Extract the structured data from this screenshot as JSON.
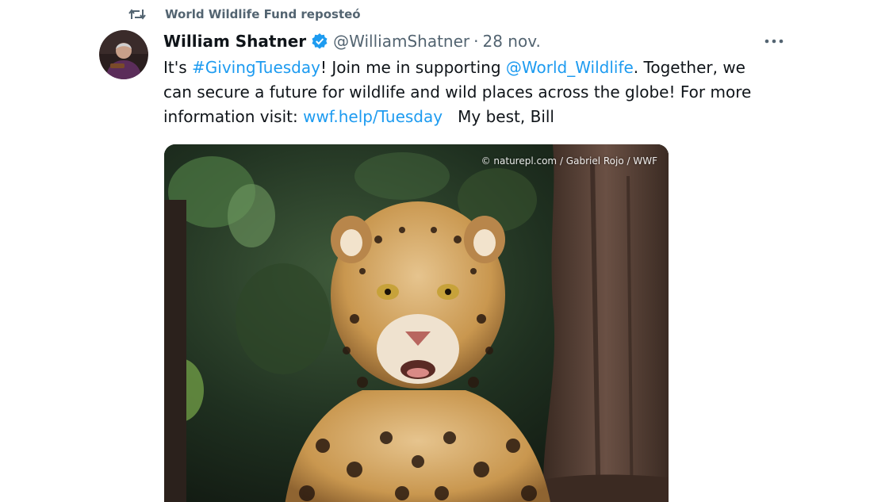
{
  "repost": {
    "label": "World Wildlife Fund reposteó",
    "icon": "repost-icon"
  },
  "tweet": {
    "author_name": "William Shatner",
    "handle": "@WilliamShatner",
    "separator": "·",
    "date": "28 nov.",
    "more_icon": "more-dots-icon",
    "text": {
      "l1_a": "It's ",
      "l1_hashtag": "#GivingTuesday",
      "l1_b": "!  Join me in supporting ",
      "l1_mention": "@World_Wildlife",
      "l1_c": ".  Together, we",
      "l2": "can secure a future for wildlife and wild places across the globe!  For more",
      "l3_a": "information visit:  ",
      "l3_link": "wwf.help/Tuesday",
      "l3_b": "   My best, Bill"
    },
    "media": {
      "credit": "© naturepl.com / Gabriel Rojo / WWF"
    }
  },
  "colors": {
    "link": "#1d9bf0",
    "muted": "#536471",
    "text": "#0f1419",
    "verified": "#1d9bf0"
  }
}
